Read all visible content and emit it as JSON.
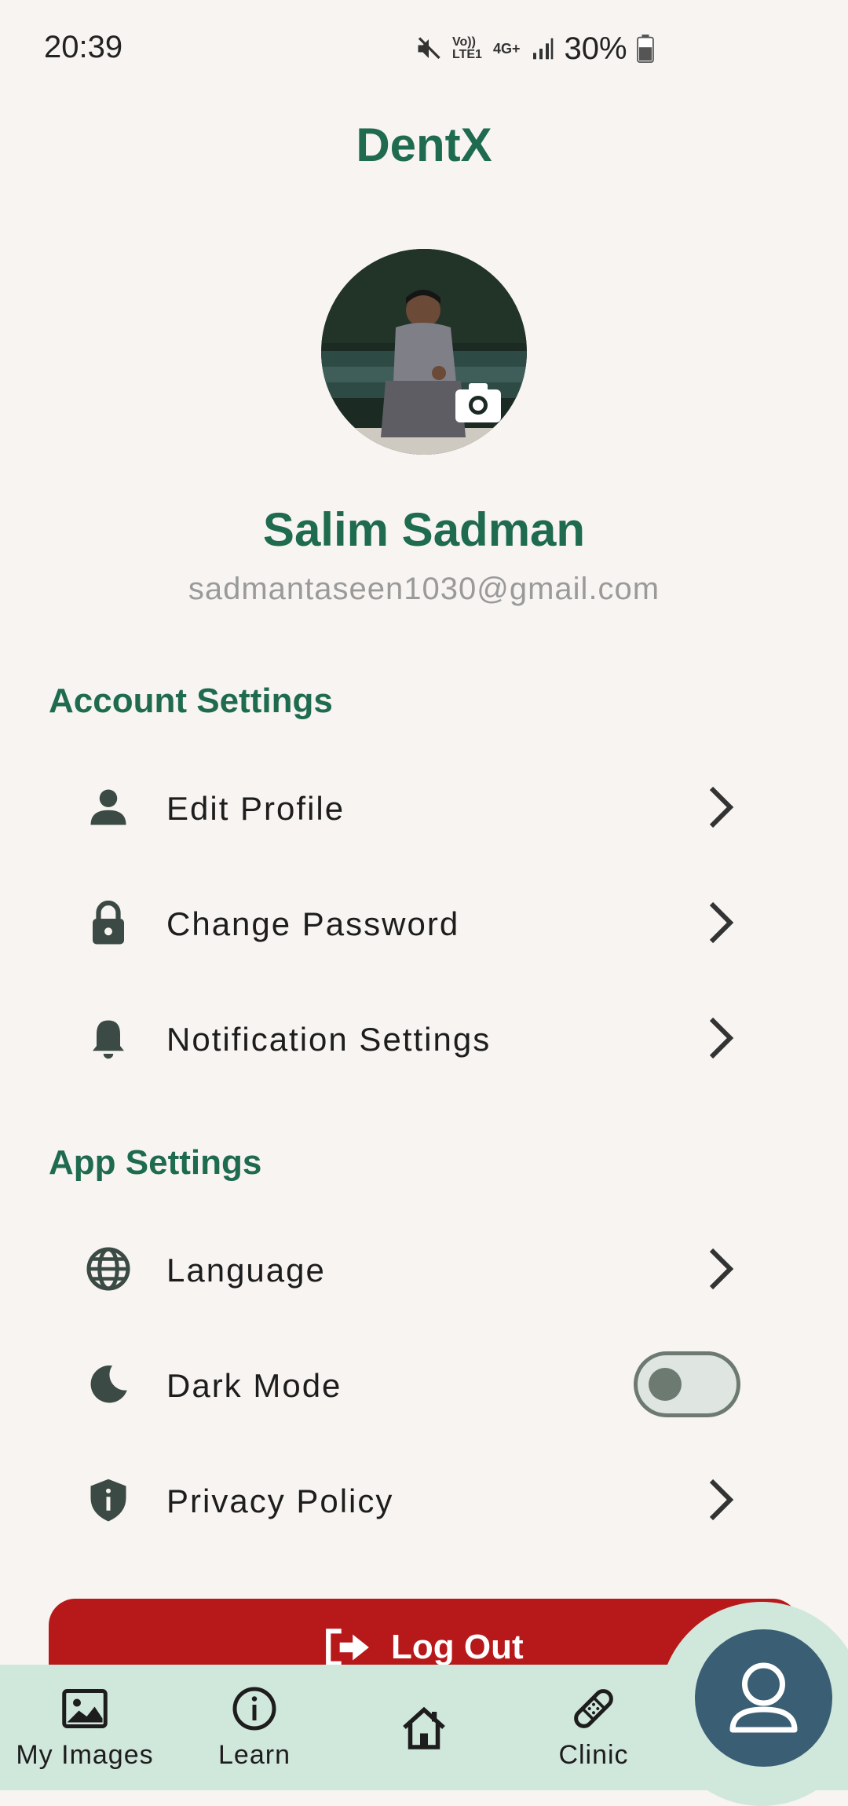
{
  "status_bar": {
    "time": "20:39",
    "network_lte": "Vo)) LTE1",
    "network_4g": "4G+",
    "battery": "30%"
  },
  "header": {
    "title": "DentX"
  },
  "profile": {
    "name": "Salim Sadman",
    "email": "sadmantaseen1030@gmail.com"
  },
  "account_settings": {
    "title": "Account Settings",
    "items": [
      {
        "label": "Edit Profile",
        "icon": "person-icon"
      },
      {
        "label": "Change Password",
        "icon": "lock-icon"
      },
      {
        "label": "Notification Settings",
        "icon": "bell-icon"
      }
    ]
  },
  "app_settings": {
    "title": "App Settings",
    "items": [
      {
        "label": "Language",
        "icon": "globe-icon"
      },
      {
        "label": "Dark Mode",
        "icon": "moon-icon",
        "toggle": false
      },
      {
        "label": "Privacy Policy",
        "icon": "shield-icon"
      }
    ]
  },
  "logout": {
    "label": "Log Out"
  },
  "bottom_nav": {
    "items": [
      {
        "label": "My Images",
        "icon": "image-icon"
      },
      {
        "label": "Learn",
        "icon": "info-icon"
      },
      {
        "label": "",
        "icon": "home-icon"
      },
      {
        "label": "Clinic",
        "icon": "bandage-icon"
      }
    ],
    "active": "profile-icon"
  },
  "colors": {
    "brand_green": "#1f6b4f",
    "logout_red": "#b7191b",
    "nav_bg": "#d0e7dc",
    "fab": "#3a5e73",
    "background": "#f7f4f1"
  }
}
